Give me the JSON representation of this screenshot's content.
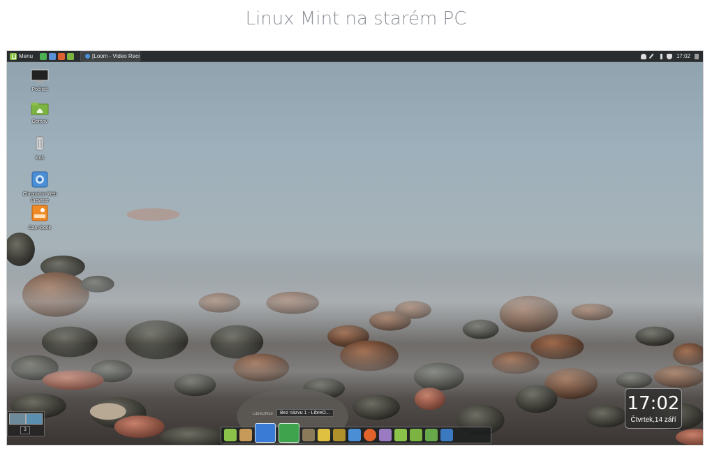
{
  "page": {
    "title": "Linux Mint na starém PC"
  },
  "top_panel": {
    "menu_label": "Menu",
    "window_button": "[Loom - Video Recor...",
    "time": "17:02"
  },
  "desktop_icons": [
    {
      "label": "Počítač",
      "icon": "computer-icon"
    },
    {
      "label": "Domov",
      "icon": "home-folder-icon"
    },
    {
      "label": "Koš",
      "icon": "trash-icon"
    },
    {
      "label": "Chromium Web Browser",
      "icon": "chromium-icon"
    },
    {
      "label": "Cam-book",
      "icon": "camera-app-icon"
    }
  ],
  "clock_widget": {
    "time": "17:02",
    "date": "Čtvrtek,14 září"
  },
  "workspaces": {
    "count": "3"
  },
  "dock": {
    "tooltip": "Bez názvu 1 - LibreO...",
    "faded_label": "LibreOffice",
    "items": [
      "mint-menu-icon",
      "archive-icon",
      "libreoffice-writer-icon",
      "libreoffice-calc-icon",
      "gimp-icon",
      "video-editor-icon",
      "image-viewer-icon",
      "chromium-icon",
      "firefox-icon",
      "pidgin-icon",
      "mint-update-icon",
      "files-icon",
      "terminal-icon",
      "accessibility-icon"
    ]
  }
}
